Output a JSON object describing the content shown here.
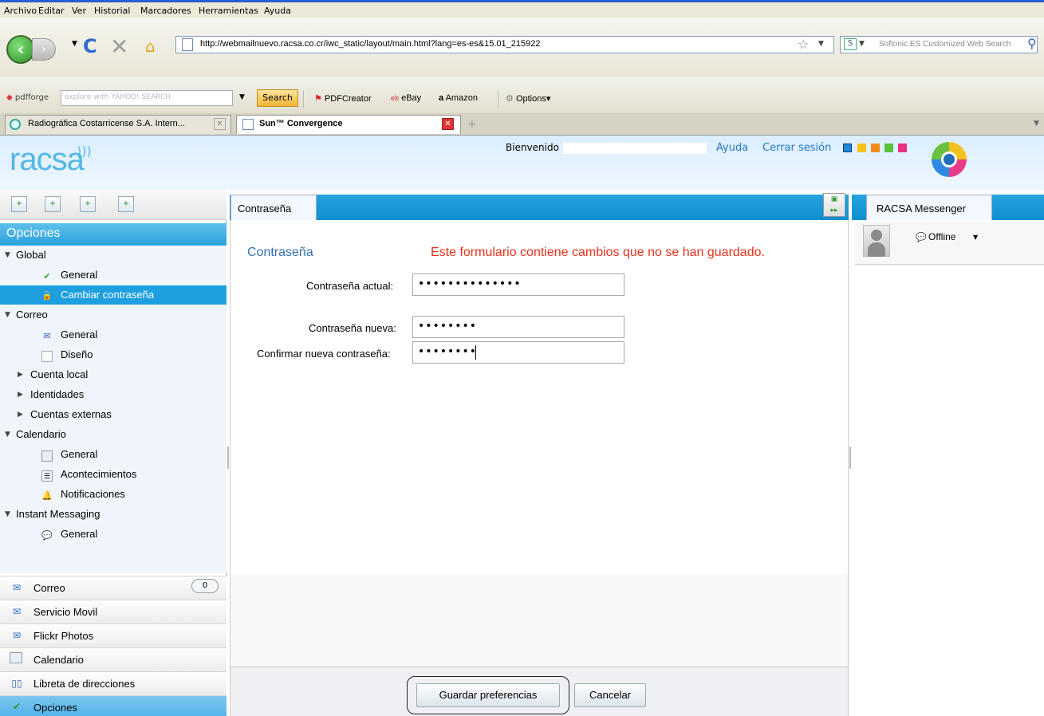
{
  "browser": {
    "menu": [
      "Archivo",
      "Editar",
      "Ver",
      "Historial",
      "Marcadores",
      "Herramientas",
      "Ayuda"
    ],
    "url": "http://webmailnuevo.racsa.co.cr/iwc_static/layout/main.html?lang=es-es&15.01_215922",
    "search_placeholder": "Softonic ES Customized Web Search",
    "toolbar": {
      "pdfforge": "pdfforge",
      "yahoo_placeholder": "explore with YAHOO! SEARCH",
      "search_btn": "Search",
      "pdfcreator": "PDFCreator",
      "ebay": "eBay",
      "amazon": "Amazon",
      "options": "Options"
    },
    "tabs": [
      {
        "label": "Radiográfica Costarricense S.A. Intern..."
      },
      {
        "label": "Sun™ Convergence"
      }
    ]
  },
  "header": {
    "logo": "racsa",
    "welcome": "Bienvenido",
    "help": "Ayuda",
    "logout": "Cerrar sesión",
    "swatches": [
      "#1e88d6",
      "#f6c21a",
      "#f38b1a",
      "#5ac13e",
      "#e8317f"
    ]
  },
  "sidebar": {
    "title": "Opciones",
    "tree": [
      {
        "label": "Global"
      },
      {
        "label": "General"
      },
      {
        "label": "Cambiar contraseña"
      },
      {
        "label": "Correo"
      },
      {
        "label": "General"
      },
      {
        "label": "Diseño"
      },
      {
        "label": "Cuenta local"
      },
      {
        "label": "Identidades"
      },
      {
        "label": "Cuentas externas"
      },
      {
        "label": "Calendario"
      },
      {
        "label": "General"
      },
      {
        "label": "Acontecimientos"
      },
      {
        "label": "Notificaciones"
      },
      {
        "label": "Instant Messaging"
      },
      {
        "label": "General"
      }
    ],
    "nav": [
      {
        "label": "Correo",
        "count": "0"
      },
      {
        "label": "Servicio Movil"
      },
      {
        "label": "Flickr Photos"
      },
      {
        "label": "Calendario"
      },
      {
        "label": "Libreta de direcciones"
      },
      {
        "label": "Opciones"
      }
    ]
  },
  "center": {
    "tab": "Contraseña",
    "form_title": "Contraseña",
    "unsaved": "Este formulario contiene cambios que no se han guardado.",
    "fields": [
      {
        "label": "Contraseña actual:",
        "value": "••••••••••••••"
      },
      {
        "label": "Contraseña nueva:",
        "value": "••••••••"
      },
      {
        "label": "Confirmar nueva contraseña:",
        "value": "••••••••"
      }
    ],
    "save": "Guardar preferencias",
    "cancel": "Cancelar"
  },
  "messenger": {
    "tab": "RACSA Messenger",
    "status": "Offline"
  }
}
